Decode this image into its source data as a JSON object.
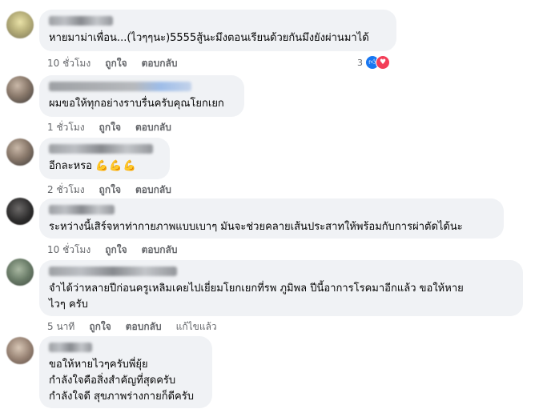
{
  "comments": [
    {
      "text_lines": [
        "หายมาม่าเพื่อน...(ไวๆๆนะ)5555สู้นะมึงตอนเรียนด้วยกันมึงยังผ่านมาได้"
      ],
      "time": "10 ชั่วโมง",
      "like": "ถูกใจ",
      "reply": "ตอบกลับ",
      "reaction_count": "3"
    },
    {
      "text_lines": [
        "ผมขอให้ทุกอย่างราบรื่นครับคุณโยกเยก"
      ],
      "time": "1 ชั่วโมง",
      "like": "ถูกใจ",
      "reply": "ตอบกลับ"
    },
    {
      "text_lines": [
        "อีกละหรอ"
      ],
      "emoji": "💪💪💪",
      "time": "2 ชั่วโมง",
      "like": "ถูกใจ",
      "reply": "ตอบกลับ"
    },
    {
      "text_lines": [
        "ระหว่างนี้เสิร์จหาท่ากายภาพแบบเบาๆ มันจะช่วยคลายเส้นประสาทให้พร้อมกับการผ่าตัดได้นะ"
      ],
      "time": "10 ชั่วโมง",
      "like": "ถูกใจ",
      "reply": "ตอบกลับ"
    },
    {
      "text_lines": [
        "จำได้ว่าหลายปีก่อนครูเหลิมเคยไปเยี่ยมโยกเยกที่รพ ภูมิพล ปีนี้อาการโรคมาอีกแล้ว ขอให้หาย",
        "ไวๆ ครับ"
      ],
      "time": "5 นาที",
      "like": "ถูกใจ",
      "reply": "ตอบกลับ",
      "edited": "แก้ไขแล้ว"
    },
    {
      "text_lines": [
        "ขอให้หายไวๆครับพี่ยุ้ย",
        "กำลังใจคือสิ่งสำคัญที่สุดครับ",
        "กำลังใจดี สุขภาพร่างกายก็ดีครับ"
      ]
    }
  ],
  "colors": {
    "bubble": "#f0f2f5",
    "meta_text": "#65676b",
    "like_reaction": "#1877f2",
    "love_reaction": "#f33e58"
  },
  "icons": {
    "like": "thumbs-up-icon",
    "love": "heart-icon"
  }
}
